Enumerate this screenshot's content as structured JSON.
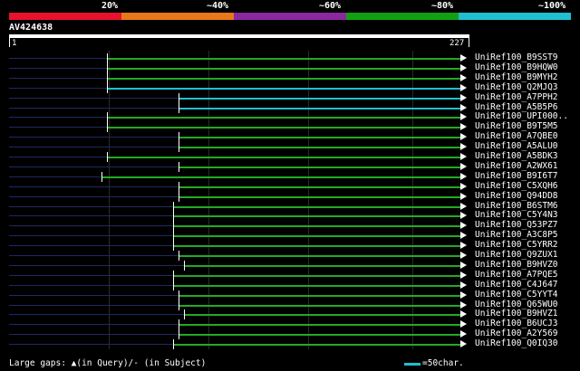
{
  "legend": {
    "colors": [
      "#e8122c",
      "#e8781a",
      "#8a28a0",
      "#12a012",
      "#1fbfcf"
    ],
    "labels": [
      "20%",
      "~40%",
      "~60%",
      "~80%",
      "~100%"
    ]
  },
  "query": {
    "id": "AV424638",
    "start": "1",
    "end": "227"
  },
  "hits": [
    {
      "name": "UniRef100_B9SST9",
      "start": 0.217,
      "color": "#22aa22"
    },
    {
      "name": "UniRef100_B9HQW0",
      "start": 0.217,
      "color": "#22aa22"
    },
    {
      "name": "UniRef100_B9MYH2",
      "start": 0.217,
      "color": "#22aa22"
    },
    {
      "name": "UniRef100_Q2MJQ3",
      "start": 0.217,
      "color": "#1fbfcf"
    },
    {
      "name": "UniRef100_A7PPH2",
      "start": 0.375,
      "color": "#1fbfcf"
    },
    {
      "name": "UniRef100_A5B5P6",
      "start": 0.375,
      "color": "#1fbfcf"
    },
    {
      "name": "UniRef100_UPI000..",
      "start": 0.217,
      "color": "#22aa22"
    },
    {
      "name": "UniRef100_B9T5M5",
      "start": 0.217,
      "color": "#22aa22"
    },
    {
      "name": "UniRef100_A7QBE0",
      "start": 0.375,
      "color": "#22aa22"
    },
    {
      "name": "UniRef100_A5ALU0",
      "start": 0.375,
      "color": "#22aa22"
    },
    {
      "name": "UniRef100_A5BDK3",
      "start": 0.217,
      "color": "#22aa22"
    },
    {
      "name": "UniRef100_A2WX61",
      "start": 0.375,
      "color": "#22aa22"
    },
    {
      "name": "UniRef100_B9I6T7",
      "start": 0.205,
      "color": "#22aa22"
    },
    {
      "name": "UniRef100_C5XQH6",
      "start": 0.375,
      "color": "#22aa22"
    },
    {
      "name": "UniRef100_Q94DD8",
      "start": 0.375,
      "color": "#22aa22"
    },
    {
      "name": "UniRef100_B6STM6",
      "start": 0.363,
      "color": "#22aa22"
    },
    {
      "name": "UniRef100_C5Y4N3",
      "start": 0.363,
      "color": "#22aa22"
    },
    {
      "name": "UniRef100_Q53PZ7",
      "start": 0.363,
      "color": "#22aa22"
    },
    {
      "name": "UniRef100_A3C8P5",
      "start": 0.363,
      "color": "#22aa22"
    },
    {
      "name": "UniRef100_C5YRR2",
      "start": 0.363,
      "color": "#22aa22"
    },
    {
      "name": "UniRef100_Q9ZUX1",
      "start": 0.375,
      "color": "#22aa22"
    },
    {
      "name": "UniRef100_B9HVZ0",
      "start": 0.387,
      "color": "#22aa22"
    },
    {
      "name": "UniRef100_A7PQE5",
      "start": 0.363,
      "color": "#22aa22"
    },
    {
      "name": "UniRef100_C4J647",
      "start": 0.363,
      "color": "#22aa22"
    },
    {
      "name": "UniRef100_C5YYT4",
      "start": 0.375,
      "color": "#22aa22"
    },
    {
      "name": "UniRef100_Q65WU0",
      "start": 0.375,
      "color": "#22aa22"
    },
    {
      "name": "UniRef100_B9HVZ1",
      "start": 0.387,
      "color": "#22aa22"
    },
    {
      "name": "UniRef100_B6UCJ3",
      "start": 0.375,
      "color": "#22aa22"
    },
    {
      "name": "UniRef100_A2Y569",
      "start": 0.375,
      "color": "#22aa22"
    },
    {
      "name": "UniRef100_Q0IQ30",
      "start": 0.363,
      "color": "#22aa22"
    }
  ],
  "footer": {
    "gaps_text": "Large gaps: ▲(in Query)/- (in Subject)",
    "scale_text": "=50char."
  }
}
